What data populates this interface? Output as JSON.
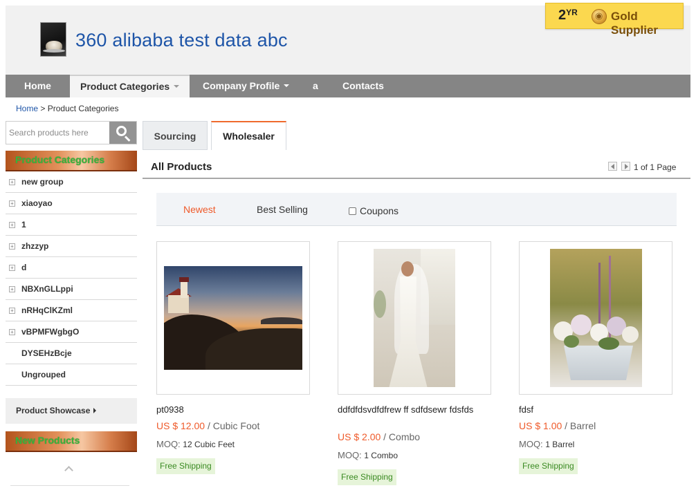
{
  "header": {
    "company_title": "360 alibaba test data abc",
    "badge_years": "2",
    "badge_years_suffix": "YR",
    "badge_label": "Gold Supplier"
  },
  "nav": {
    "items": [
      {
        "label": "Home"
      },
      {
        "label": "Product Categories"
      },
      {
        "label": "Company Profile"
      },
      {
        "label": "a"
      },
      {
        "label": "Contacts"
      }
    ]
  },
  "breadcrumb": {
    "home": "Home",
    "separator": ">",
    "current": "Product Categories"
  },
  "sidebar": {
    "search_placeholder": "Search products here",
    "categories_banner": "Product Categories",
    "categories": [
      {
        "label": "new group"
      },
      {
        "label": "xiaoyao"
      },
      {
        "label": "1"
      },
      {
        "label": "zhzzyp"
      },
      {
        "label": "d"
      },
      {
        "label": "NBXnGLLppi"
      },
      {
        "label": "nRHqClKZml"
      },
      {
        "label": "vBPMFWgbgO"
      },
      {
        "label": "DYSEHzBcje"
      },
      {
        "label": "Ungrouped"
      }
    ],
    "showcase_label": "Product Showcase",
    "new_products_banner": "New Products"
  },
  "tabs": {
    "sourcing": "Sourcing",
    "wholesaler": "Wholesaler"
  },
  "main": {
    "section_title": "All Products",
    "pager_text": "1 of 1 Page",
    "sort_newest": "Newest",
    "sort_best_selling": "Best Selling",
    "coupons_label": "Coupons"
  },
  "products": [
    {
      "name": "pt0938",
      "price": "US $ 12.00",
      "price_unit": "/ Cubic Foot",
      "moq_label": "MOQ:",
      "moq_value": "12 Cubic Feet",
      "shipping": "Free Shipping"
    },
    {
      "name": "ddfdfdsvdfdfrew ff sdfdsewr fdsfds",
      "price": "US $ 2.00",
      "price_unit": "/ Combo",
      "moq_label": "MOQ:",
      "moq_value": "1 Combo",
      "shipping": "Free Shipping"
    },
    {
      "name": "fdsf",
      "price": "US $ 1.00",
      "price_unit": "/ Barrel",
      "moq_label": "MOQ:",
      "moq_value": "1 Barrel",
      "shipping": "Free Shipping"
    }
  ],
  "colors": {
    "accent_orange": "#ef5a2a",
    "link_blue": "#1e55a8",
    "nav_gray": "#858585",
    "gold": "#fbd84f",
    "shipping_green": "#3a8a22"
  }
}
